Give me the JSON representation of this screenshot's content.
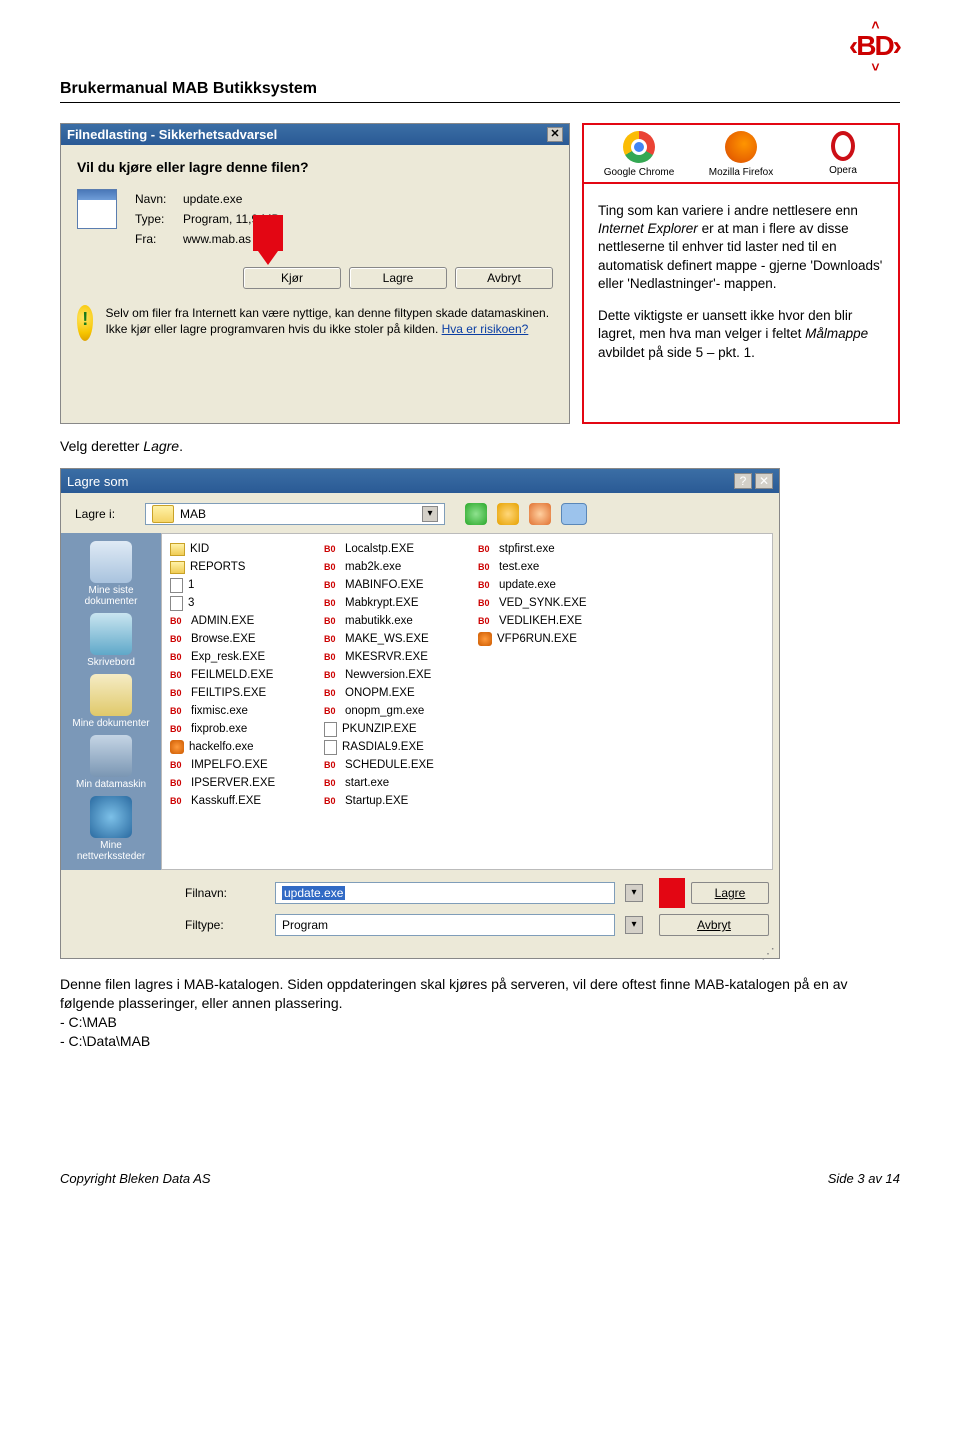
{
  "header": {
    "doc_title": "Brukermanual MAB Butikksystem",
    "logo_text": "‹BD›"
  },
  "dialog1": {
    "title": "Filnedlasting - Sikkerhetsadvarsel",
    "heading": "Vil du kjøre eller lagre denne filen?",
    "name_label": "Navn:",
    "name_value": "update.exe",
    "type_label": "Type:",
    "type_value": "Program, 11,9 MB",
    "from_label": "Fra:",
    "from_value": "www.mab.as",
    "btn_run": "Kjør",
    "btn_save": "Lagre",
    "btn_cancel": "Avbryt",
    "warn_text_1": "Selv om filer fra Internett kan være nyttige, kan denne filtypen skade datamaskinen. Ikke kjør eller lagre programvaren hvis du ikke stoler på kilden. ",
    "warn_link": "Hva er risikoen?"
  },
  "browsers": {
    "chrome": "Google Chrome",
    "firefox": "Mozilla Firefox",
    "opera": "Opera"
  },
  "sidebox": {
    "p1a": "Ting som kan variere i andre nettlesere enn ",
    "p1b": "Internet Explorer",
    "p1c": " er at man i flere av disse nettleserne til enhver tid laster ned til en automatisk definert mappe - gjerne 'Downloads' eller 'Nedlastninger'- mappen.",
    "p2a": "Dette viktigste er uansett ikke hvor den blir lagret, men hva man velger i feltet ",
    "p2b": "Målmappe",
    "p2c": " avbildet på side 5 – pkt. 1."
  },
  "mid": {
    "text_a": "Velg deretter ",
    "text_b": "Lagre",
    "text_c": "."
  },
  "dialog2": {
    "title": "Lagre som",
    "save_in_label": "Lagre i:",
    "save_in_value": "MAB",
    "places": {
      "recent": "Mine siste dokumenter",
      "desktop": "Skrivebord",
      "mydocs": "Mine dokumenter",
      "mycomp": "Min datamaskin",
      "network": "Mine nettverkssteder"
    },
    "files_col1": [
      {
        "t": "folder",
        "n": "KID"
      },
      {
        "t": "folder",
        "n": "REPORTS"
      },
      {
        "t": "doc",
        "n": "1"
      },
      {
        "t": "doc",
        "n": "3"
      },
      {
        "t": "bd",
        "n": "ADMIN.EXE"
      },
      {
        "t": "bd",
        "n": "Browse.EXE"
      },
      {
        "t": "bd",
        "n": "Exp_resk.EXE"
      },
      {
        "t": "bd",
        "n": "FEILMELD.EXE"
      },
      {
        "t": "bd",
        "n": "FEILTIPS.EXE"
      },
      {
        "t": "bd",
        "n": "fixmisc.exe"
      },
      {
        "t": "bd",
        "n": "fixprob.exe"
      },
      {
        "t": "fox",
        "n": "hackelfo.exe"
      },
      {
        "t": "bd",
        "n": "IMPELFO.EXE"
      },
      {
        "t": "bd",
        "n": "IPSERVER.EXE"
      },
      {
        "t": "bd",
        "n": "Kasskuff.EXE"
      }
    ],
    "files_col2": [
      {
        "t": "bd",
        "n": "Localstp.EXE"
      },
      {
        "t": "bd",
        "n": "mab2k.exe"
      },
      {
        "t": "bd",
        "n": "MABINFO.EXE"
      },
      {
        "t": "bd",
        "n": "Mabkrypt.EXE"
      },
      {
        "t": "bd",
        "n": "mabutikk.exe"
      },
      {
        "t": "bd",
        "n": "MAKE_WS.EXE"
      },
      {
        "t": "bd",
        "n": "MKESRVR.EXE"
      },
      {
        "t": "bd",
        "n": "Newversion.EXE"
      },
      {
        "t": "bd",
        "n": "ONOPM.EXE"
      },
      {
        "t": "bd",
        "n": "onopm_gm.exe"
      },
      {
        "t": "doc",
        "n": "PKUNZIP.EXE"
      },
      {
        "t": "doc",
        "n": "RASDIAL9.EXE"
      },
      {
        "t": "bd",
        "n": "SCHEDULE.EXE"
      },
      {
        "t": "bd",
        "n": "start.exe"
      },
      {
        "t": "bd",
        "n": "Startup.EXE"
      }
    ],
    "files_col3": [
      {
        "t": "bd",
        "n": "stpfirst.exe"
      },
      {
        "t": "bd",
        "n": "test.exe"
      },
      {
        "t": "bd",
        "n": "update.exe"
      },
      {
        "t": "bd",
        "n": "VED_SYNK.EXE"
      },
      {
        "t": "bd",
        "n": "VEDLIKEH.EXE"
      },
      {
        "t": "fox",
        "n": "VFP6RUN.EXE"
      }
    ],
    "filename_label": "Filnavn:",
    "filename_value": "update.exe",
    "filetype_label": "Filtype:",
    "filetype_value": "Program",
    "btn_save": "Lagre",
    "btn_cancel": "Avbryt"
  },
  "body": {
    "p1": "Denne filen lagres i MAB-katalogen. Siden oppdateringen skal kjøres på serveren, vil dere oftest finne MAB-katalogen på en av følgende plasseringer, eller annen plassering.",
    "l1": "- C:\\MAB",
    "l2": "- C:\\Data\\MAB"
  },
  "footer": {
    "left": "Copyright Bleken Data AS",
    "right": "Side 3 av 14"
  }
}
